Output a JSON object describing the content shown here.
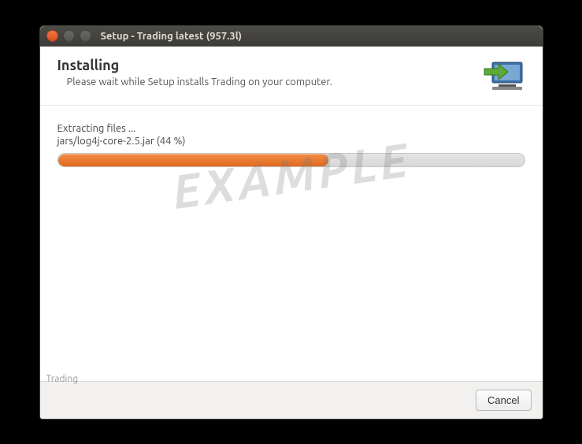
{
  "window": {
    "title": "Setup - Trading latest (957.3l)"
  },
  "header": {
    "title": "Installing",
    "subtitle": "Please wait while Setup installs Trading on your computer."
  },
  "progress": {
    "status": "Extracting files ...",
    "file": "jars/log4j-core-2.5.jar (44 %)",
    "percent": 58
  },
  "footer": {
    "brand": "Trading",
    "cancel": "Cancel"
  },
  "watermark": "EXAMPLE"
}
